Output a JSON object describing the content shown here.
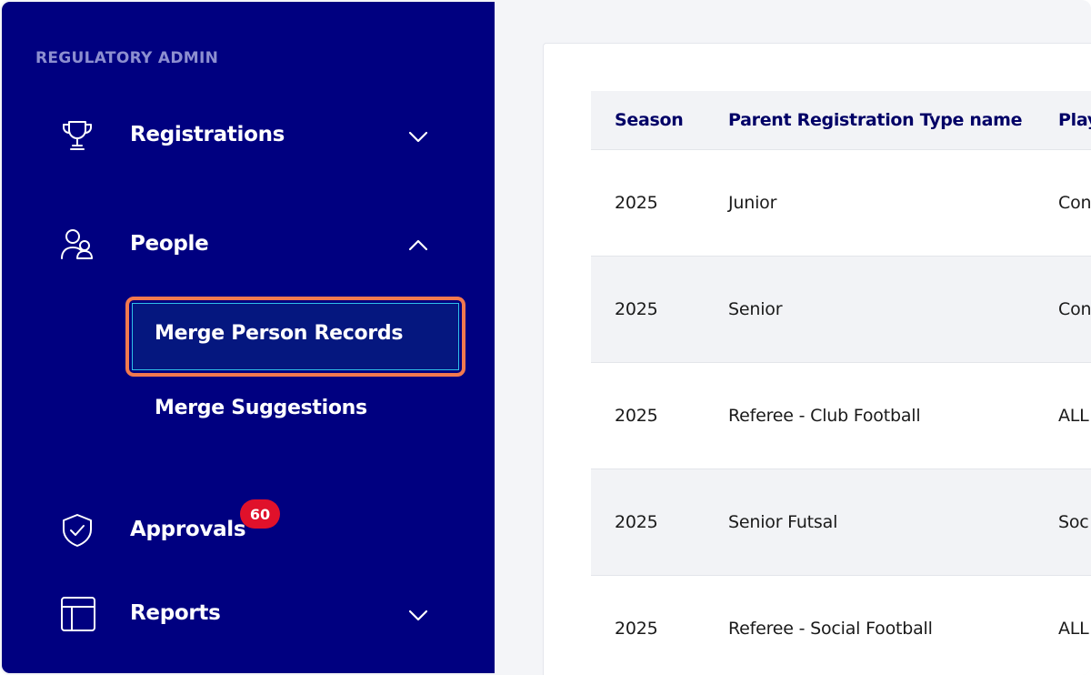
{
  "sidebar": {
    "section_label": "REGULATORY ADMIN",
    "items": [
      {
        "label": "Registrations",
        "icon": "trophy-icon",
        "chevron": "down"
      },
      {
        "label": "People",
        "icon": "people-icon",
        "chevron": "up"
      },
      {
        "label": "Approvals",
        "icon": "shield-check-icon",
        "badge": "60"
      },
      {
        "label": "Reports",
        "icon": "table-layout-icon",
        "chevron": "down"
      }
    ],
    "people_subitems": [
      {
        "label": "Merge Person Records",
        "active": true
      },
      {
        "label": "Merge Suggestions",
        "active": false
      }
    ],
    "colors": {
      "background": "#000080",
      "highlight_border": "#f2794f",
      "badge": "#e0112b"
    }
  },
  "table": {
    "columns": [
      "Season",
      "Parent Registration Type name",
      "Play"
    ],
    "rows": [
      [
        "2025",
        "Junior",
        "Con"
      ],
      [
        "2025",
        "Senior",
        "Con"
      ],
      [
        "2025",
        "Referee - Club Football",
        "ALL"
      ],
      [
        "2025",
        "Senior Futsal",
        "Soc"
      ],
      [
        "2025",
        "Referee - Social Football",
        "ALL"
      ]
    ]
  }
}
